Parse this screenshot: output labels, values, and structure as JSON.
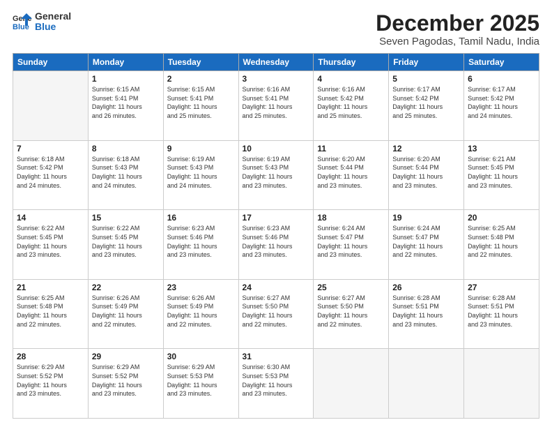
{
  "logo": {
    "line1": "General",
    "line2": "Blue"
  },
  "title": "December 2025",
  "subtitle": "Seven Pagodas, Tamil Nadu, India",
  "days_header": [
    "Sunday",
    "Monday",
    "Tuesday",
    "Wednesday",
    "Thursday",
    "Friday",
    "Saturday"
  ],
  "weeks": [
    [
      {
        "num": "",
        "info": ""
      },
      {
        "num": "1",
        "info": "Sunrise: 6:15 AM\nSunset: 5:41 PM\nDaylight: 11 hours\nand 26 minutes."
      },
      {
        "num": "2",
        "info": "Sunrise: 6:15 AM\nSunset: 5:41 PM\nDaylight: 11 hours\nand 25 minutes."
      },
      {
        "num": "3",
        "info": "Sunrise: 6:16 AM\nSunset: 5:41 PM\nDaylight: 11 hours\nand 25 minutes."
      },
      {
        "num": "4",
        "info": "Sunrise: 6:16 AM\nSunset: 5:42 PM\nDaylight: 11 hours\nand 25 minutes."
      },
      {
        "num": "5",
        "info": "Sunrise: 6:17 AM\nSunset: 5:42 PM\nDaylight: 11 hours\nand 25 minutes."
      },
      {
        "num": "6",
        "info": "Sunrise: 6:17 AM\nSunset: 5:42 PM\nDaylight: 11 hours\nand 24 minutes."
      }
    ],
    [
      {
        "num": "7",
        "info": "Sunrise: 6:18 AM\nSunset: 5:42 PM\nDaylight: 11 hours\nand 24 minutes."
      },
      {
        "num": "8",
        "info": "Sunrise: 6:18 AM\nSunset: 5:43 PM\nDaylight: 11 hours\nand 24 minutes."
      },
      {
        "num": "9",
        "info": "Sunrise: 6:19 AM\nSunset: 5:43 PM\nDaylight: 11 hours\nand 24 minutes."
      },
      {
        "num": "10",
        "info": "Sunrise: 6:19 AM\nSunset: 5:43 PM\nDaylight: 11 hours\nand 23 minutes."
      },
      {
        "num": "11",
        "info": "Sunrise: 6:20 AM\nSunset: 5:44 PM\nDaylight: 11 hours\nand 23 minutes."
      },
      {
        "num": "12",
        "info": "Sunrise: 6:20 AM\nSunset: 5:44 PM\nDaylight: 11 hours\nand 23 minutes."
      },
      {
        "num": "13",
        "info": "Sunrise: 6:21 AM\nSunset: 5:45 PM\nDaylight: 11 hours\nand 23 minutes."
      }
    ],
    [
      {
        "num": "14",
        "info": "Sunrise: 6:22 AM\nSunset: 5:45 PM\nDaylight: 11 hours\nand 23 minutes."
      },
      {
        "num": "15",
        "info": "Sunrise: 6:22 AM\nSunset: 5:45 PM\nDaylight: 11 hours\nand 23 minutes."
      },
      {
        "num": "16",
        "info": "Sunrise: 6:23 AM\nSunset: 5:46 PM\nDaylight: 11 hours\nand 23 minutes."
      },
      {
        "num": "17",
        "info": "Sunrise: 6:23 AM\nSunset: 5:46 PM\nDaylight: 11 hours\nand 23 minutes."
      },
      {
        "num": "18",
        "info": "Sunrise: 6:24 AM\nSunset: 5:47 PM\nDaylight: 11 hours\nand 23 minutes."
      },
      {
        "num": "19",
        "info": "Sunrise: 6:24 AM\nSunset: 5:47 PM\nDaylight: 11 hours\nand 22 minutes."
      },
      {
        "num": "20",
        "info": "Sunrise: 6:25 AM\nSunset: 5:48 PM\nDaylight: 11 hours\nand 22 minutes."
      }
    ],
    [
      {
        "num": "21",
        "info": "Sunrise: 6:25 AM\nSunset: 5:48 PM\nDaylight: 11 hours\nand 22 minutes."
      },
      {
        "num": "22",
        "info": "Sunrise: 6:26 AM\nSunset: 5:49 PM\nDaylight: 11 hours\nand 22 minutes."
      },
      {
        "num": "23",
        "info": "Sunrise: 6:26 AM\nSunset: 5:49 PM\nDaylight: 11 hours\nand 22 minutes."
      },
      {
        "num": "24",
        "info": "Sunrise: 6:27 AM\nSunset: 5:50 PM\nDaylight: 11 hours\nand 22 minutes."
      },
      {
        "num": "25",
        "info": "Sunrise: 6:27 AM\nSunset: 5:50 PM\nDaylight: 11 hours\nand 22 minutes."
      },
      {
        "num": "26",
        "info": "Sunrise: 6:28 AM\nSunset: 5:51 PM\nDaylight: 11 hours\nand 23 minutes."
      },
      {
        "num": "27",
        "info": "Sunrise: 6:28 AM\nSunset: 5:51 PM\nDaylight: 11 hours\nand 23 minutes."
      }
    ],
    [
      {
        "num": "28",
        "info": "Sunrise: 6:29 AM\nSunset: 5:52 PM\nDaylight: 11 hours\nand 23 minutes."
      },
      {
        "num": "29",
        "info": "Sunrise: 6:29 AM\nSunset: 5:52 PM\nDaylight: 11 hours\nand 23 minutes."
      },
      {
        "num": "30",
        "info": "Sunrise: 6:29 AM\nSunset: 5:53 PM\nDaylight: 11 hours\nand 23 minutes."
      },
      {
        "num": "31",
        "info": "Sunrise: 6:30 AM\nSunset: 5:53 PM\nDaylight: 11 hours\nand 23 minutes."
      },
      {
        "num": "",
        "info": ""
      },
      {
        "num": "",
        "info": ""
      },
      {
        "num": "",
        "info": ""
      }
    ]
  ]
}
